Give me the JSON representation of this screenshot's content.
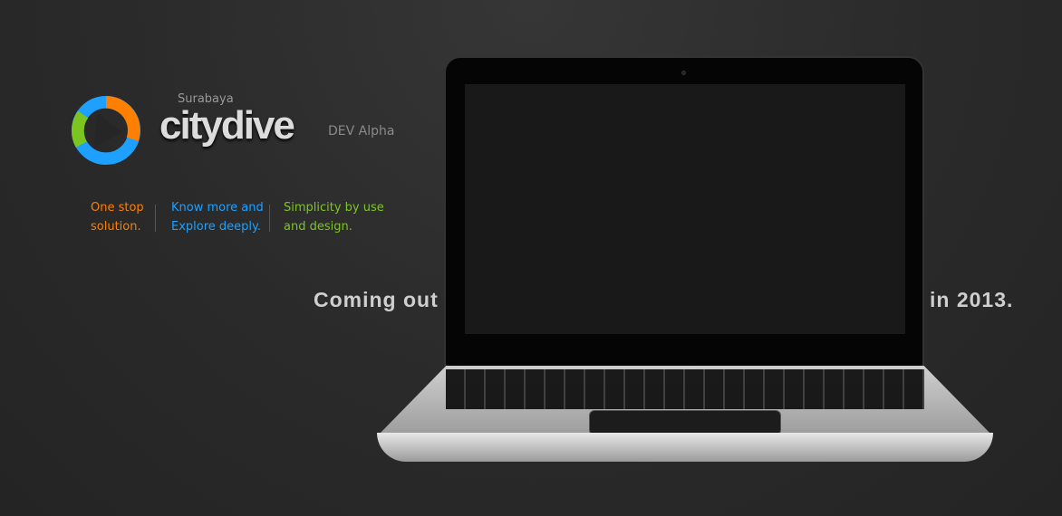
{
  "brand": {
    "city": "Surabaya",
    "name": "citydive",
    "version": "DEV Alpha",
    "logo_colors": [
      "#ff7f00",
      "#1ea0ff",
      "#7cc520"
    ]
  },
  "taglines": [
    {
      "line1": "One stop",
      "line2": "solution.",
      "color": "#ff7f00"
    },
    {
      "line1": "Know more and",
      "line2": "Explore deeply.",
      "color": "#1ea0ff"
    },
    {
      "line1": "Simplicity by use",
      "line2": "and design.",
      "color": "#7cc520"
    }
  ],
  "announcement": {
    "left": "Coming out",
    "right": "in 2013."
  }
}
